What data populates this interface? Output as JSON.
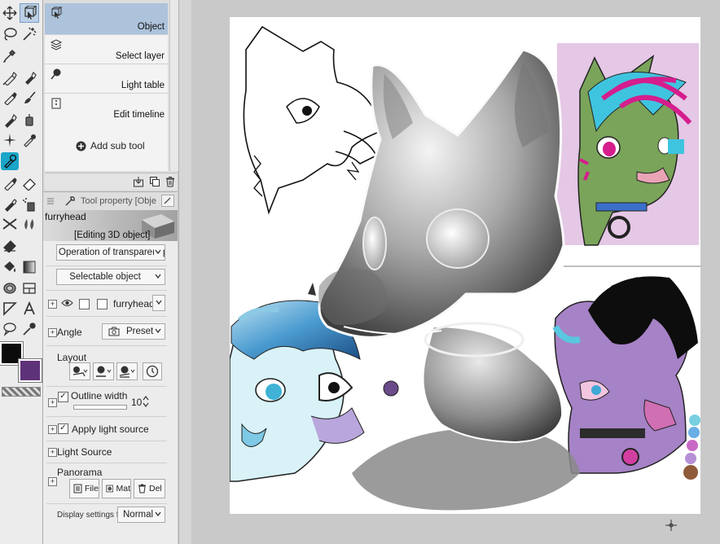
{
  "tools": [
    {
      "name": "move-icon",
      "active": false
    },
    {
      "name": "object-select-icon",
      "active": true
    },
    {
      "name": "lasso-icon",
      "active": false
    },
    {
      "name": "magic-wand-icon",
      "active": false
    },
    {
      "name": "eyedropper-icon",
      "active": false
    },
    {
      "name": "pen-icon",
      "active": false
    },
    {
      "name": "marker-icon",
      "active": false
    },
    {
      "name": "pencil-icon",
      "active": false
    },
    {
      "name": "brush-icon",
      "active": false
    },
    {
      "name": "fill-pen-icon",
      "active": false
    },
    {
      "name": "airbrush-icon",
      "active": false
    },
    {
      "name": "decoration-icon",
      "active": false
    },
    {
      "name": "ink-icon",
      "active": false
    },
    {
      "name": "blend-icon",
      "active": true
    },
    {
      "name": "pen2-icon",
      "active": false
    },
    {
      "name": "eraser-icon",
      "active": false
    },
    {
      "name": "pen3-icon",
      "active": false
    },
    {
      "name": "spray-icon",
      "active": false
    },
    {
      "name": "scissors-icon",
      "active": false
    },
    {
      "name": "blur-icon",
      "active": false
    },
    {
      "name": "eraser2-icon",
      "active": false
    },
    {
      "name": "fill-icon",
      "active": false
    },
    {
      "name": "gradient-icon",
      "active": false
    },
    {
      "name": "contour-icon",
      "active": false
    },
    {
      "name": "frame-icon",
      "active": false
    },
    {
      "name": "ruler-icon",
      "active": false
    },
    {
      "name": "text-icon",
      "active": false
    },
    {
      "name": "balloon-icon",
      "active": false
    },
    {
      "name": "correct-line-icon",
      "active": false
    }
  ],
  "colors": {
    "main": "#0b0b0b",
    "sub": "#5e3279",
    "accent": "#adc3dc"
  },
  "subtools": [
    {
      "label": "Object",
      "selected": true,
      "icon": "object-icon"
    },
    {
      "label": "Select layer",
      "selected": false,
      "icon": "select-layer-icon"
    },
    {
      "label": "Light table",
      "selected": false,
      "icon": "light-table-icon"
    },
    {
      "label": "Edit timeline",
      "selected": false,
      "icon": "edit-timeline-icon"
    }
  ],
  "add_sub_tool": "Add sub tool",
  "property": {
    "title": "Tool property [Obje",
    "preview_name": "furryhead",
    "editing": "[Editing 3D object]",
    "operation_transparent": "Operation of transparent part",
    "selectable": "Selectable object",
    "object_name": "furryhead",
    "angle_label": "Angle",
    "preset_label": "Preset",
    "layout_label": "Layout",
    "outline_label": "Outline width",
    "outline_value": "10",
    "apply_light_label": "Apply light source",
    "light_source_label": "Light Source",
    "panorama_label": "Panorama",
    "pano_file": "File",
    "pano_mat": "Mat",
    "pano_del": "Del",
    "display_label": "Display settings for r",
    "display_value": "Normal"
  }
}
